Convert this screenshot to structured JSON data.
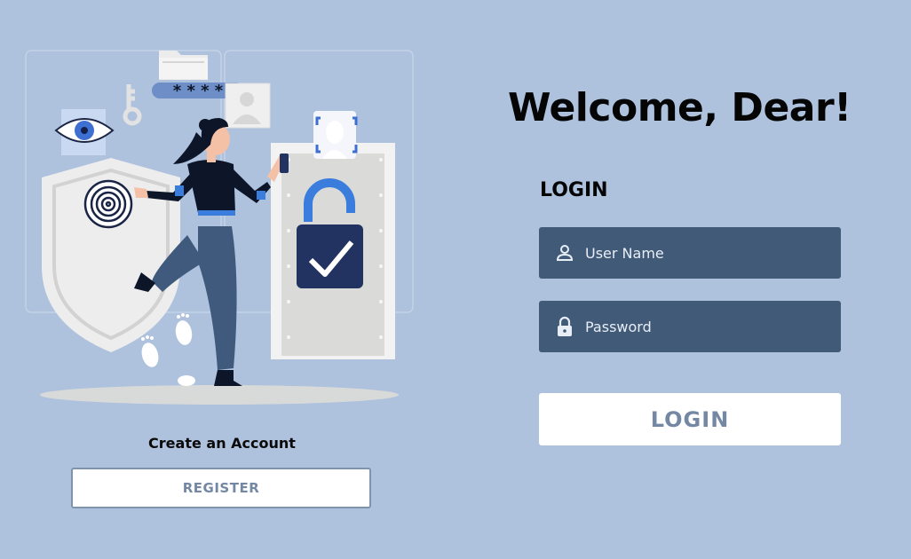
{
  "welcome_title": "Welcome, Dear!",
  "login_heading": "LOGIN",
  "username": {
    "placeholder": "User Name",
    "icon": "user-icon"
  },
  "password": {
    "placeholder": "Password",
    "icon": "lock-icon"
  },
  "login_button": "LOGIN",
  "create_account_label": "Create an Account",
  "register_button": "REGISTER",
  "illustration": {
    "password_mask": "* * * *"
  },
  "colors": {
    "background": "#aec2de",
    "field": "#405a78",
    "button_text": "#7488a4",
    "lock_body": "#223362",
    "lock_shackle": "#3b7ddd"
  }
}
